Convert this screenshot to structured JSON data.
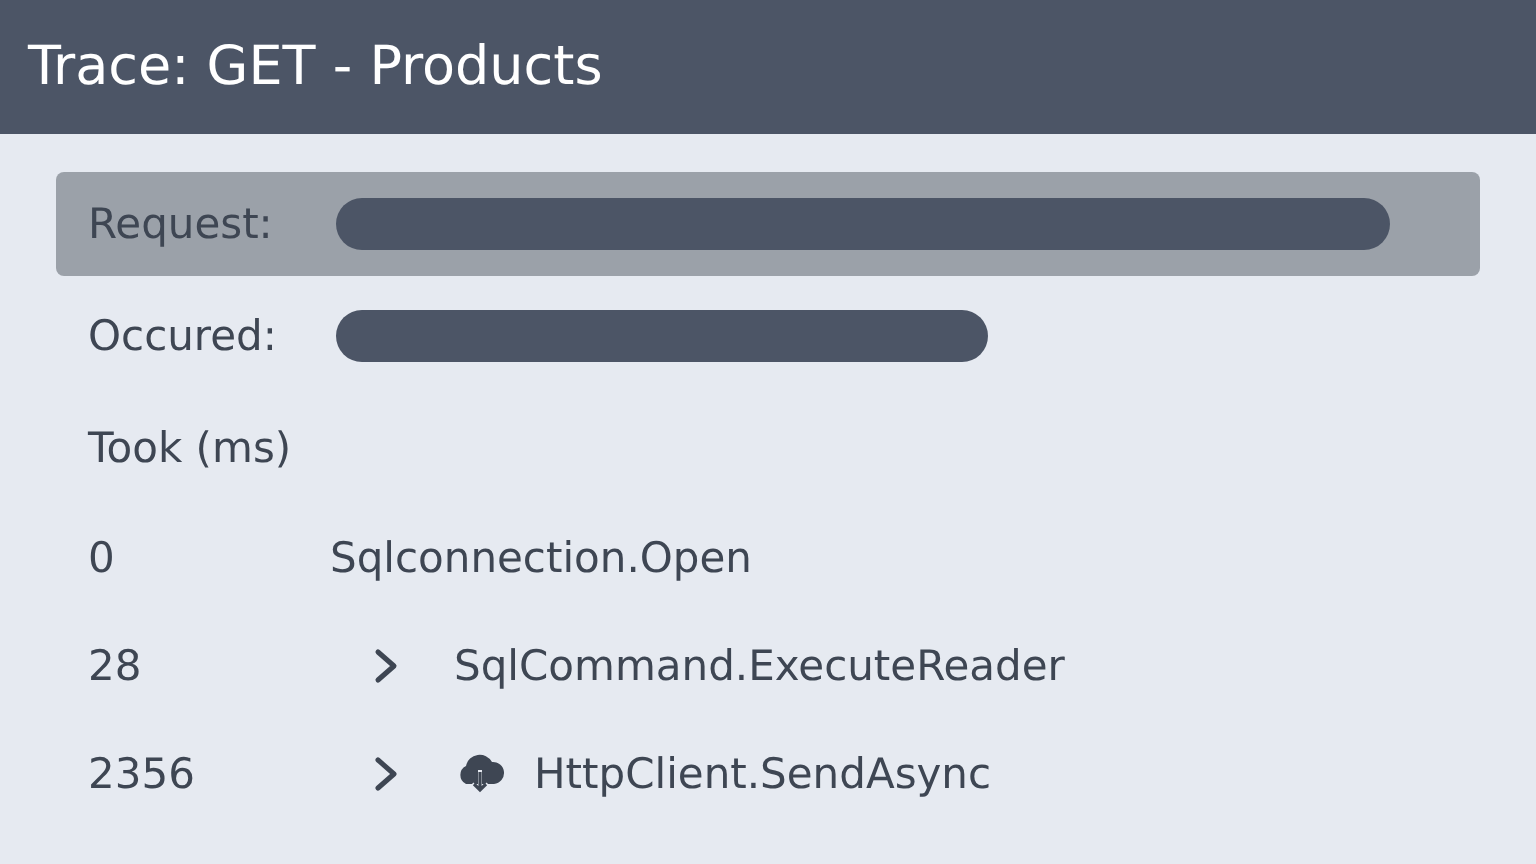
{
  "window": {
    "title": "Trace: GET - Products"
  },
  "fields": [
    {
      "label": "Request:",
      "selected": true
    },
    {
      "label": "Occured:",
      "selected": false
    }
  ],
  "trace": {
    "heading": "Took (ms)",
    "rows": [
      {
        "time": "0",
        "name": "Sqlconnection.Open",
        "expandable": false,
        "kind": "plain"
      },
      {
        "time": "28",
        "name": "SqlCommand.ExecuteReader",
        "expandable": true,
        "kind": "plain"
      },
      {
        "time": "2356",
        "name": "HttpClient.SendAsync",
        "expandable": true,
        "kind": "cloud"
      }
    ]
  }
}
